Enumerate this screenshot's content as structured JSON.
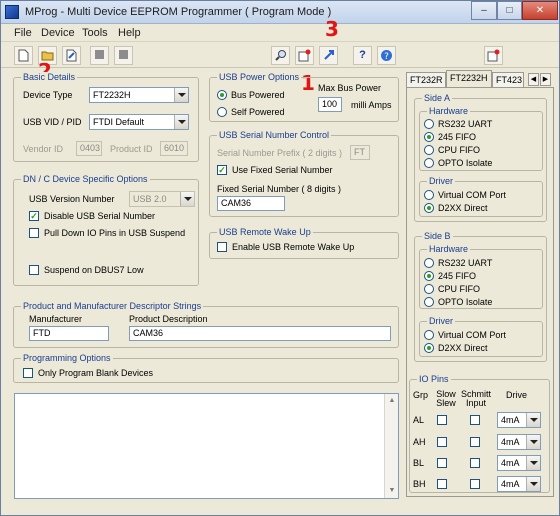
{
  "window": {
    "title": "MProg - Multi Device EEPROM Programmer ( Program Mode )",
    "controls": {
      "minimize": "–",
      "maximize": "□",
      "close": "✕"
    }
  },
  "menu": [
    "File",
    "Device",
    "Tools",
    "Help"
  ],
  "toolbar": {
    "icons": [
      "new-file-icon",
      "open-folder-icon",
      "edit-icon",
      "stop-icon",
      "stop-icon",
      "search-icon",
      "program-icon",
      "program-all-icon",
      "help-icon",
      "about-icon",
      "exit-icon"
    ]
  },
  "annotations": {
    "a1": "1",
    "a2": "2",
    "a3": "3"
  },
  "basic": {
    "legend": "Basic Details",
    "device_type_label": "Device Type",
    "device_type_value": "FT2232H",
    "vidpid_label": "USB VID / PID",
    "vidpid_value": "FTDI Default",
    "vendor_label": "Vendor ID",
    "vendor_value": "0403",
    "product_label": "Product ID",
    "product_value": "6010"
  },
  "power": {
    "legend": "USB Power Options",
    "bus_label": "Bus Powered",
    "self_label": "Self Powered",
    "max_label": "Max Bus Power",
    "max_value": "100",
    "unit_label": "milli Amps"
  },
  "serial": {
    "legend": "USB Serial Number Control",
    "prefix_label": "Serial Number Prefix ( 2 digits )",
    "prefix_value": "FT",
    "use_fixed_label": "Use Fixed Serial Number",
    "fixed_label": "Fixed Serial Number ( 8 digits )",
    "fixed_value": "CAM36"
  },
  "wake": {
    "legend": "USB Remote Wake Up",
    "enable_label": "Enable USB Remote Wake Up"
  },
  "dnc": {
    "legend": "DN / C Device Specific Options",
    "version_label": "USB Version Number",
    "version_value": "USB 2.0",
    "disable_serial_label": "Disable USB Serial Number",
    "pulldown_label": "Pull Down IO Pins in USB Suspend",
    "suspend_label": "Suspend on DBUS7 Low"
  },
  "descriptor": {
    "legend": "Product and Manufacturer Descriptor Strings",
    "manufacturer_label": "Manufacturer",
    "manufacturer_value": "FTD",
    "product_label": "Product Description",
    "product_value": "CAM36"
  },
  "programming": {
    "legend": "Programming Options",
    "blank_label": "Only Program Blank Devices"
  },
  "tabs": [
    "FT232R",
    "FT2232H",
    "FT423"
  ],
  "side_a": {
    "legend": "Side A",
    "hardware_legend": "Hardware",
    "hardware": [
      "RS232 UART",
      "245 FIFO",
      "CPU FIFO",
      "OPTO Isolate"
    ],
    "driver_legend": "Driver",
    "driver": [
      "Virtual COM Port",
      "D2XX Direct"
    ]
  },
  "side_b": {
    "legend": "Side B",
    "hardware_legend": "Hardware",
    "hardware": [
      "RS232 UART",
      "245 FIFO",
      "CPU FIFO",
      "OPTO Isolate"
    ],
    "driver_legend": "Driver",
    "driver": [
      "Virtual COM Port",
      "D2XX Direct"
    ]
  },
  "io": {
    "legend": "IO Pins",
    "headers": {
      "grp": "Grp",
      "slow": "Slow Slew",
      "schmitt": "Schmitt Input",
      "drive": "Drive"
    },
    "rows": [
      {
        "grp": "AL",
        "drive": "4mA"
      },
      {
        "grp": "AH",
        "drive": "4mA"
      },
      {
        "grp": "BL",
        "drive": "4mA"
      },
      {
        "grp": "BH",
        "drive": "4mA"
      }
    ]
  },
  "colors": {
    "accent": "#1a3d8f",
    "annotation": "#e01616",
    "check": "#21a121"
  }
}
